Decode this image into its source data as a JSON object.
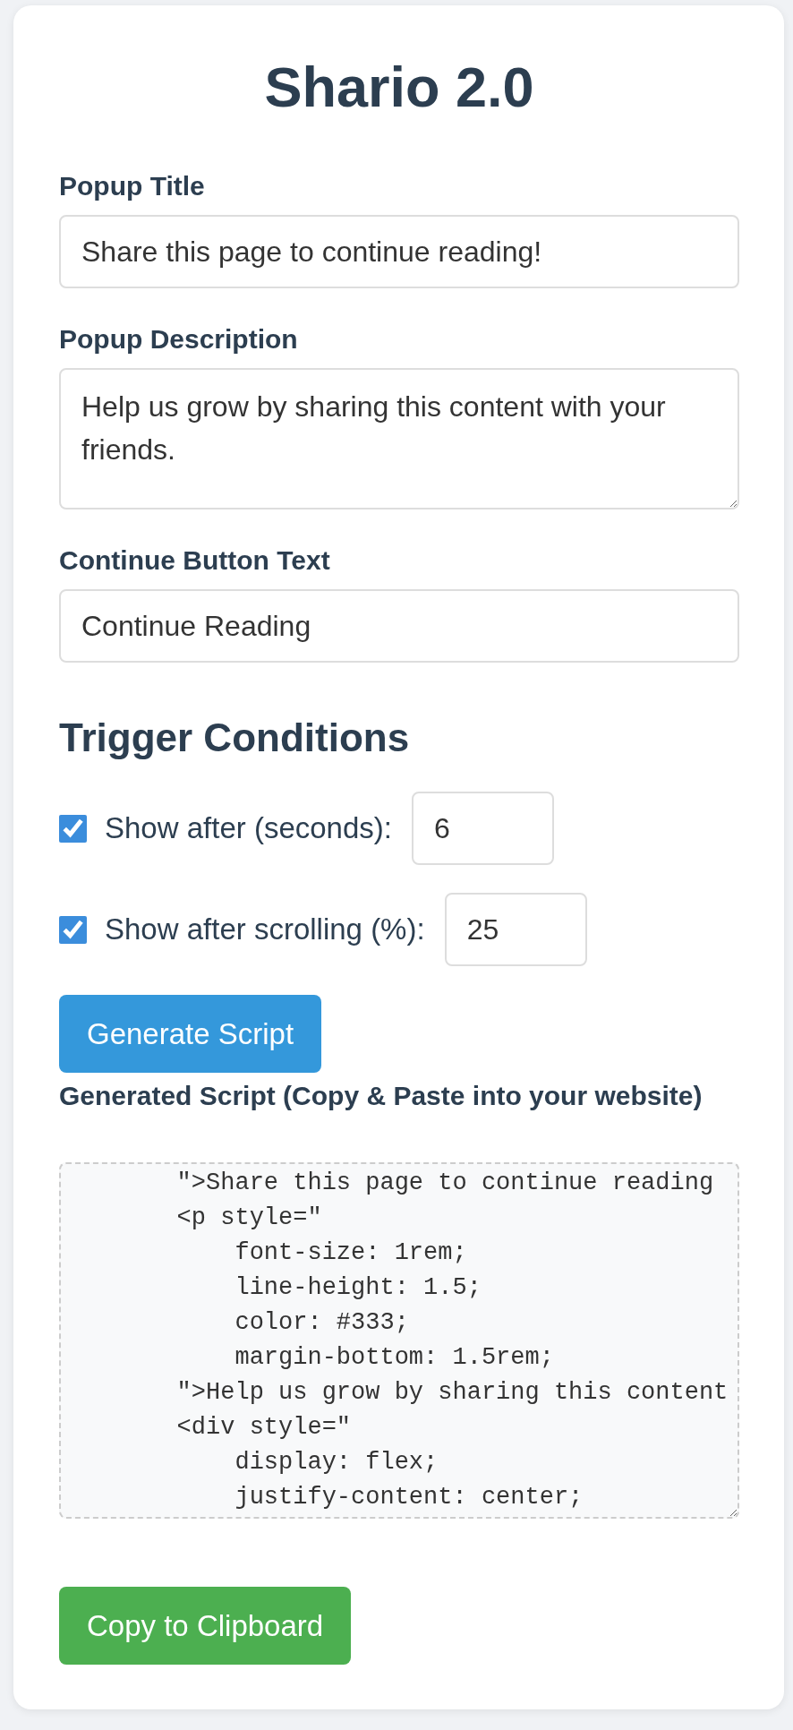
{
  "title": "Shario 2.0",
  "fields": [
    {
      "kind": "input",
      "label": "Popup Title",
      "value": "Share this page to continue reading!"
    },
    {
      "kind": "textarea",
      "label": "Popup Description",
      "value": "Help us grow by sharing this content with your friends."
    },
    {
      "kind": "input",
      "label": "Continue Button Text",
      "value": "Continue Reading"
    }
  ],
  "trigger_conditions": {
    "heading": "Trigger Conditions",
    "conditions": [
      {
        "label": "Show after (seconds):",
        "checked": true,
        "value": "6"
      },
      {
        "label": "Show after scrolling (%):",
        "checked": true,
        "value": "25"
      }
    ]
  },
  "generate_button": "Generate Script",
  "output": {
    "label": "Generated Script (Copy & Paste into your website)",
    "code": "        \">Share this page to continue reading\n        <p style=\"\n            font-size: 1rem;\n            line-height: 1.5;\n            color: #333;\n            margin-bottom: 1.5rem;\n        \">Help us grow by sharing this content\n        <div style=\"\n            display: flex;\n            justify-content: center;"
  },
  "copy_button": "Copy to Clipboard"
}
